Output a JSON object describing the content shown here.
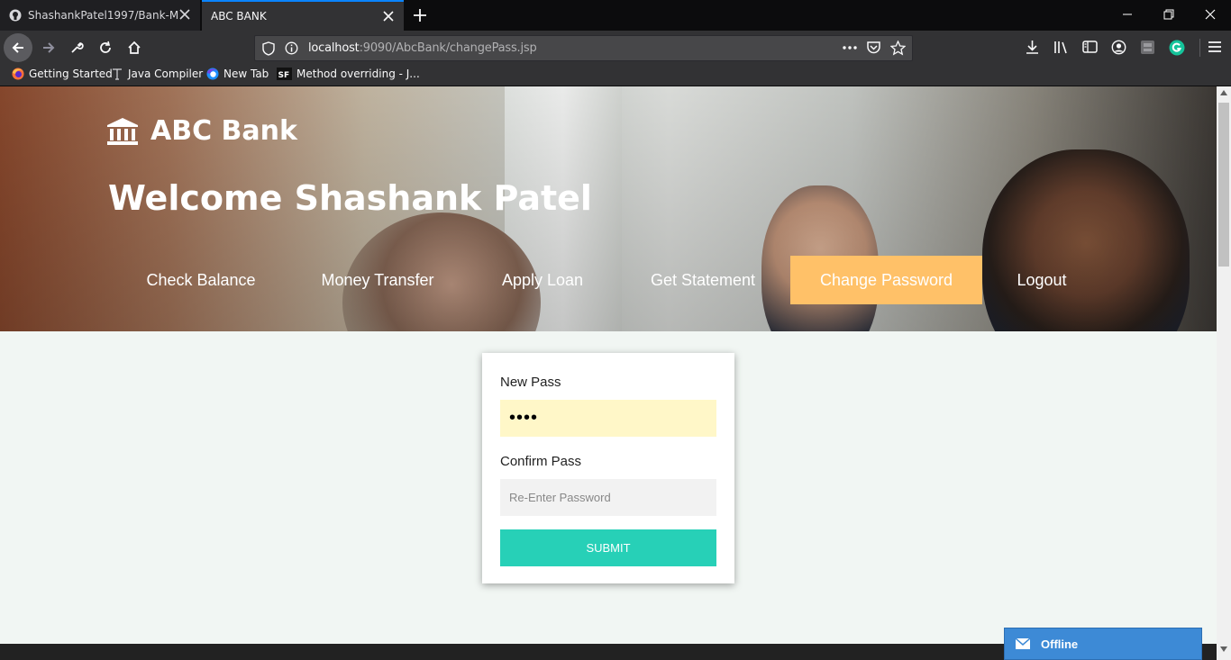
{
  "browser": {
    "tabs": [
      {
        "title": "ShashankPatel1997/Bank-Mana",
        "active": false
      },
      {
        "title": "ABC BANK",
        "active": true
      }
    ],
    "url_host": "localhost",
    "url_rest": ":9090/AbcBank/changePass.jsp",
    "bookmarks": [
      {
        "label": "Getting Started"
      },
      {
        "label": "Java Compiler"
      },
      {
        "label": "New Tab"
      },
      {
        "label": "Method overriding - J..."
      }
    ]
  },
  "header": {
    "brand": "ABC Bank",
    "welcome": "Welcome Shashank Patel",
    "menu": [
      {
        "label": "Check Balance"
      },
      {
        "label": "Money Transfer"
      },
      {
        "label": "Apply Loan"
      },
      {
        "label": "Get Statement"
      },
      {
        "label": "Change Password",
        "active": true
      },
      {
        "label": "Logout"
      }
    ]
  },
  "form": {
    "new_pass_label": "New Pass",
    "new_pass_value": "••••",
    "confirm_label": "Confirm Pass",
    "confirm_placeholder": "Re-Enter Password",
    "submit_label": "SUBMIT"
  },
  "chat": {
    "status": "Offline"
  },
  "colors": {
    "accent": "#ffc168",
    "submit": "#27d0b7",
    "chat": "#3d8ad6",
    "tab_highlight": "#0a84ff"
  }
}
